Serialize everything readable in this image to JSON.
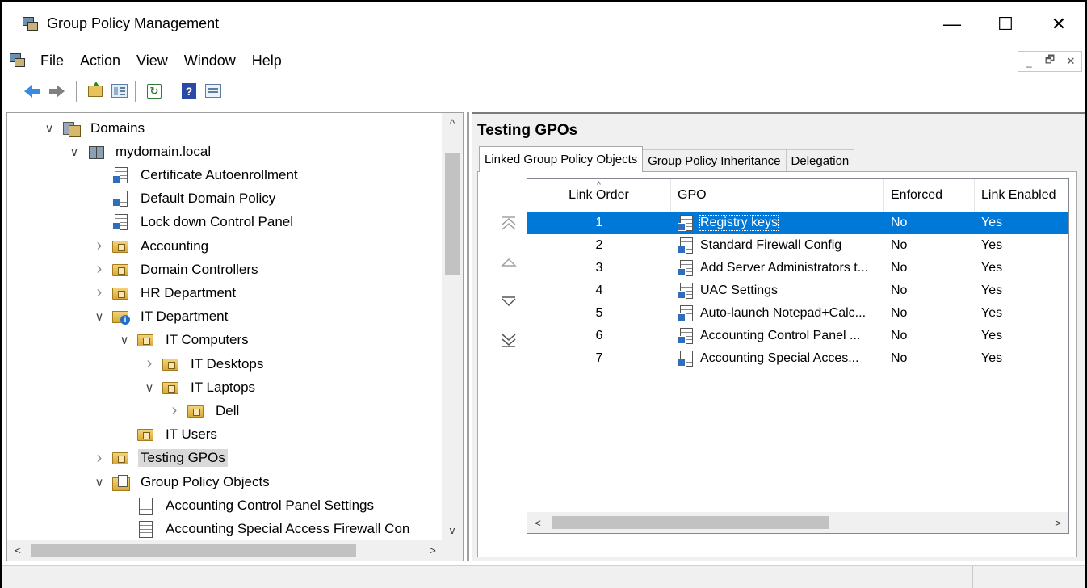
{
  "window": {
    "title": "Group Policy Management"
  },
  "window_controls": {
    "minimize": "—",
    "maximize": "☐",
    "close": "✕"
  },
  "menu": [
    "File",
    "Action",
    "View",
    "Window",
    "Help"
  ],
  "mdi_controls": {
    "minimize": "_",
    "restore": "🗗",
    "close": "✕"
  },
  "toolbar": {
    "buttons": [
      "back-arrow",
      "forward-arrow",
      "up-one-level",
      "show-hide-console-tree",
      "refresh",
      "help",
      "show-hide-action-pane"
    ]
  },
  "tree": [
    {
      "label": "Domains",
      "icon": "domains-icon",
      "depth": 0,
      "chevron": "expanded"
    },
    {
      "label": "mydomain.local",
      "icon": "domain-icon",
      "depth": 1,
      "chevron": "expanded"
    },
    {
      "label": "Certificate Autoenrollment",
      "icon": "gpo-link-icon",
      "depth": 2,
      "chevron": "none"
    },
    {
      "label": "Default Domain Policy",
      "icon": "gpo-link-icon",
      "depth": 2,
      "chevron": "none"
    },
    {
      "label": "Lock down Control Panel",
      "icon": "gpo-link-icon",
      "depth": 2,
      "chevron": "none"
    },
    {
      "label": "Accounting",
      "icon": "ou-folder-icon",
      "depth": 2,
      "chevron": "collapsed"
    },
    {
      "label": "Domain Controllers",
      "icon": "ou-folder-icon",
      "depth": 2,
      "chevron": "collapsed"
    },
    {
      "label": "HR Department",
      "icon": "ou-folder-icon",
      "depth": 2,
      "chevron": "collapsed"
    },
    {
      "label": "IT Department",
      "icon": "ou-info-icon",
      "depth": 2,
      "chevron": "expanded"
    },
    {
      "label": "IT Computers",
      "icon": "ou-folder-icon",
      "depth": 3,
      "chevron": "expanded"
    },
    {
      "label": "IT Desktops",
      "icon": "ou-folder-icon",
      "depth": 4,
      "chevron": "collapsed"
    },
    {
      "label": "IT Laptops",
      "icon": "ou-folder-icon",
      "depth": 4,
      "chevron": "expanded"
    },
    {
      "label": "Dell",
      "icon": "ou-folder-icon",
      "depth": 5,
      "chevron": "collapsed"
    },
    {
      "label": "IT Users",
      "icon": "ou-folder-icon",
      "depth": 3,
      "chevron": "none"
    },
    {
      "label": "Testing GPOs",
      "icon": "ou-folder-icon",
      "depth": 2,
      "chevron": "collapsed",
      "selected": true
    },
    {
      "label": "Group Policy Objects",
      "icon": "gpo-container-icon",
      "depth": 2,
      "chevron": "expanded"
    },
    {
      "label": "Accounting Control Panel Settings",
      "icon": "gpo-icon",
      "depth": 3,
      "chevron": "none"
    },
    {
      "label": "Accounting Special Access Firewall Con",
      "icon": "gpo-icon",
      "depth": 3,
      "chevron": "none"
    }
  ],
  "scroll_glyphs": {
    "up": "^",
    "down": "v",
    "left": "<",
    "right": ">"
  },
  "details": {
    "title": "Testing GPOs",
    "tabs": [
      {
        "label": "Linked Group Policy Objects",
        "active": true
      },
      {
        "label": "Group Policy Inheritance",
        "active": false
      },
      {
        "label": "Delegation",
        "active": false
      }
    ],
    "columns": [
      "Link Order",
      "GPO",
      "Enforced",
      "Link Enabled"
    ],
    "sort_glyph": "^",
    "rows": [
      {
        "order": "1",
        "gpo": "Registry keys",
        "enforced": "No",
        "enabled": "Yes",
        "selected": true
      },
      {
        "order": "2",
        "gpo": "Standard Firewall Config",
        "enforced": "No",
        "enabled": "Yes"
      },
      {
        "order": "3",
        "gpo": "Add Server Administrators t...",
        "enforced": "No",
        "enabled": "Yes"
      },
      {
        "order": "4",
        "gpo": "UAC Settings",
        "enforced": "No",
        "enabled": "Yes"
      },
      {
        "order": "5",
        "gpo": "Auto-launch Notepad+Calc...",
        "enforced": "No",
        "enabled": "Yes"
      },
      {
        "order": "6",
        "gpo": "Accounting Control Panel ...",
        "enforced": "No",
        "enabled": "Yes"
      },
      {
        "order": "7",
        "gpo": "Accounting Special Acces...",
        "enforced": "No",
        "enabled": "Yes"
      }
    ]
  },
  "colors": {
    "selection": "#0078d7",
    "tree_selection": "#d9d9d9",
    "chrome": "#f0f0f0"
  }
}
